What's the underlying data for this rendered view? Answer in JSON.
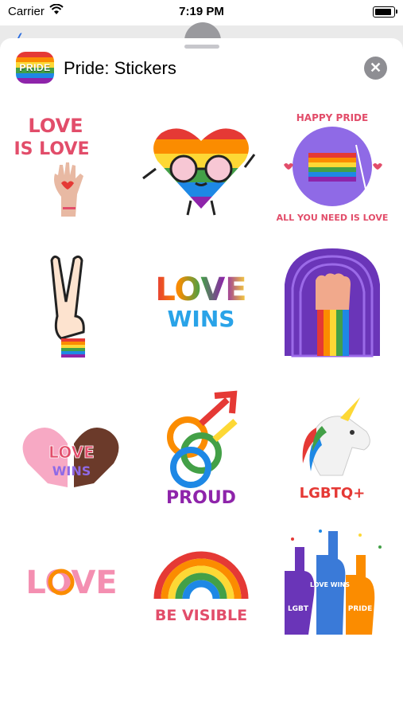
{
  "status_bar": {
    "carrier": "Carrier",
    "time": "7:19 PM"
  },
  "sheet": {
    "title": "Pride: Stickers",
    "app_icon_text": "PRIDE"
  },
  "stickers": [
    {
      "name": "love-is-love",
      "line1": "LOVE",
      "line2": "IS LOVE"
    },
    {
      "name": "heart-with-glasses"
    },
    {
      "name": "happy-pride-flag",
      "top": "HAPPY PRIDE",
      "bottom": "ALL YOU NEED IS LOVE"
    },
    {
      "name": "peace-hand"
    },
    {
      "name": "love-wins",
      "line1": "LOVE",
      "line2": "WINS"
    },
    {
      "name": "raised-fist"
    },
    {
      "name": "heart-hands",
      "line1": "LOVE",
      "line2": "WINS"
    },
    {
      "name": "gender-symbols",
      "label": "PROUD"
    },
    {
      "name": "unicorn",
      "label": "LGBTQ+"
    },
    {
      "name": "love-text",
      "label": "LOVE"
    },
    {
      "name": "be-visible",
      "label": "BE VISIBLE"
    },
    {
      "name": "foam-fingers",
      "labels": [
        "LGBT",
        "LOVE WINS",
        "PRIDE"
      ]
    }
  ],
  "colors": {
    "rainbow": [
      "#e53935",
      "#fb8c00",
      "#fdd835",
      "#43a047",
      "#1e88e5",
      "#8e24aa"
    ],
    "accent_pink": "#e24d6a",
    "purple": "#7a4fd6"
  }
}
